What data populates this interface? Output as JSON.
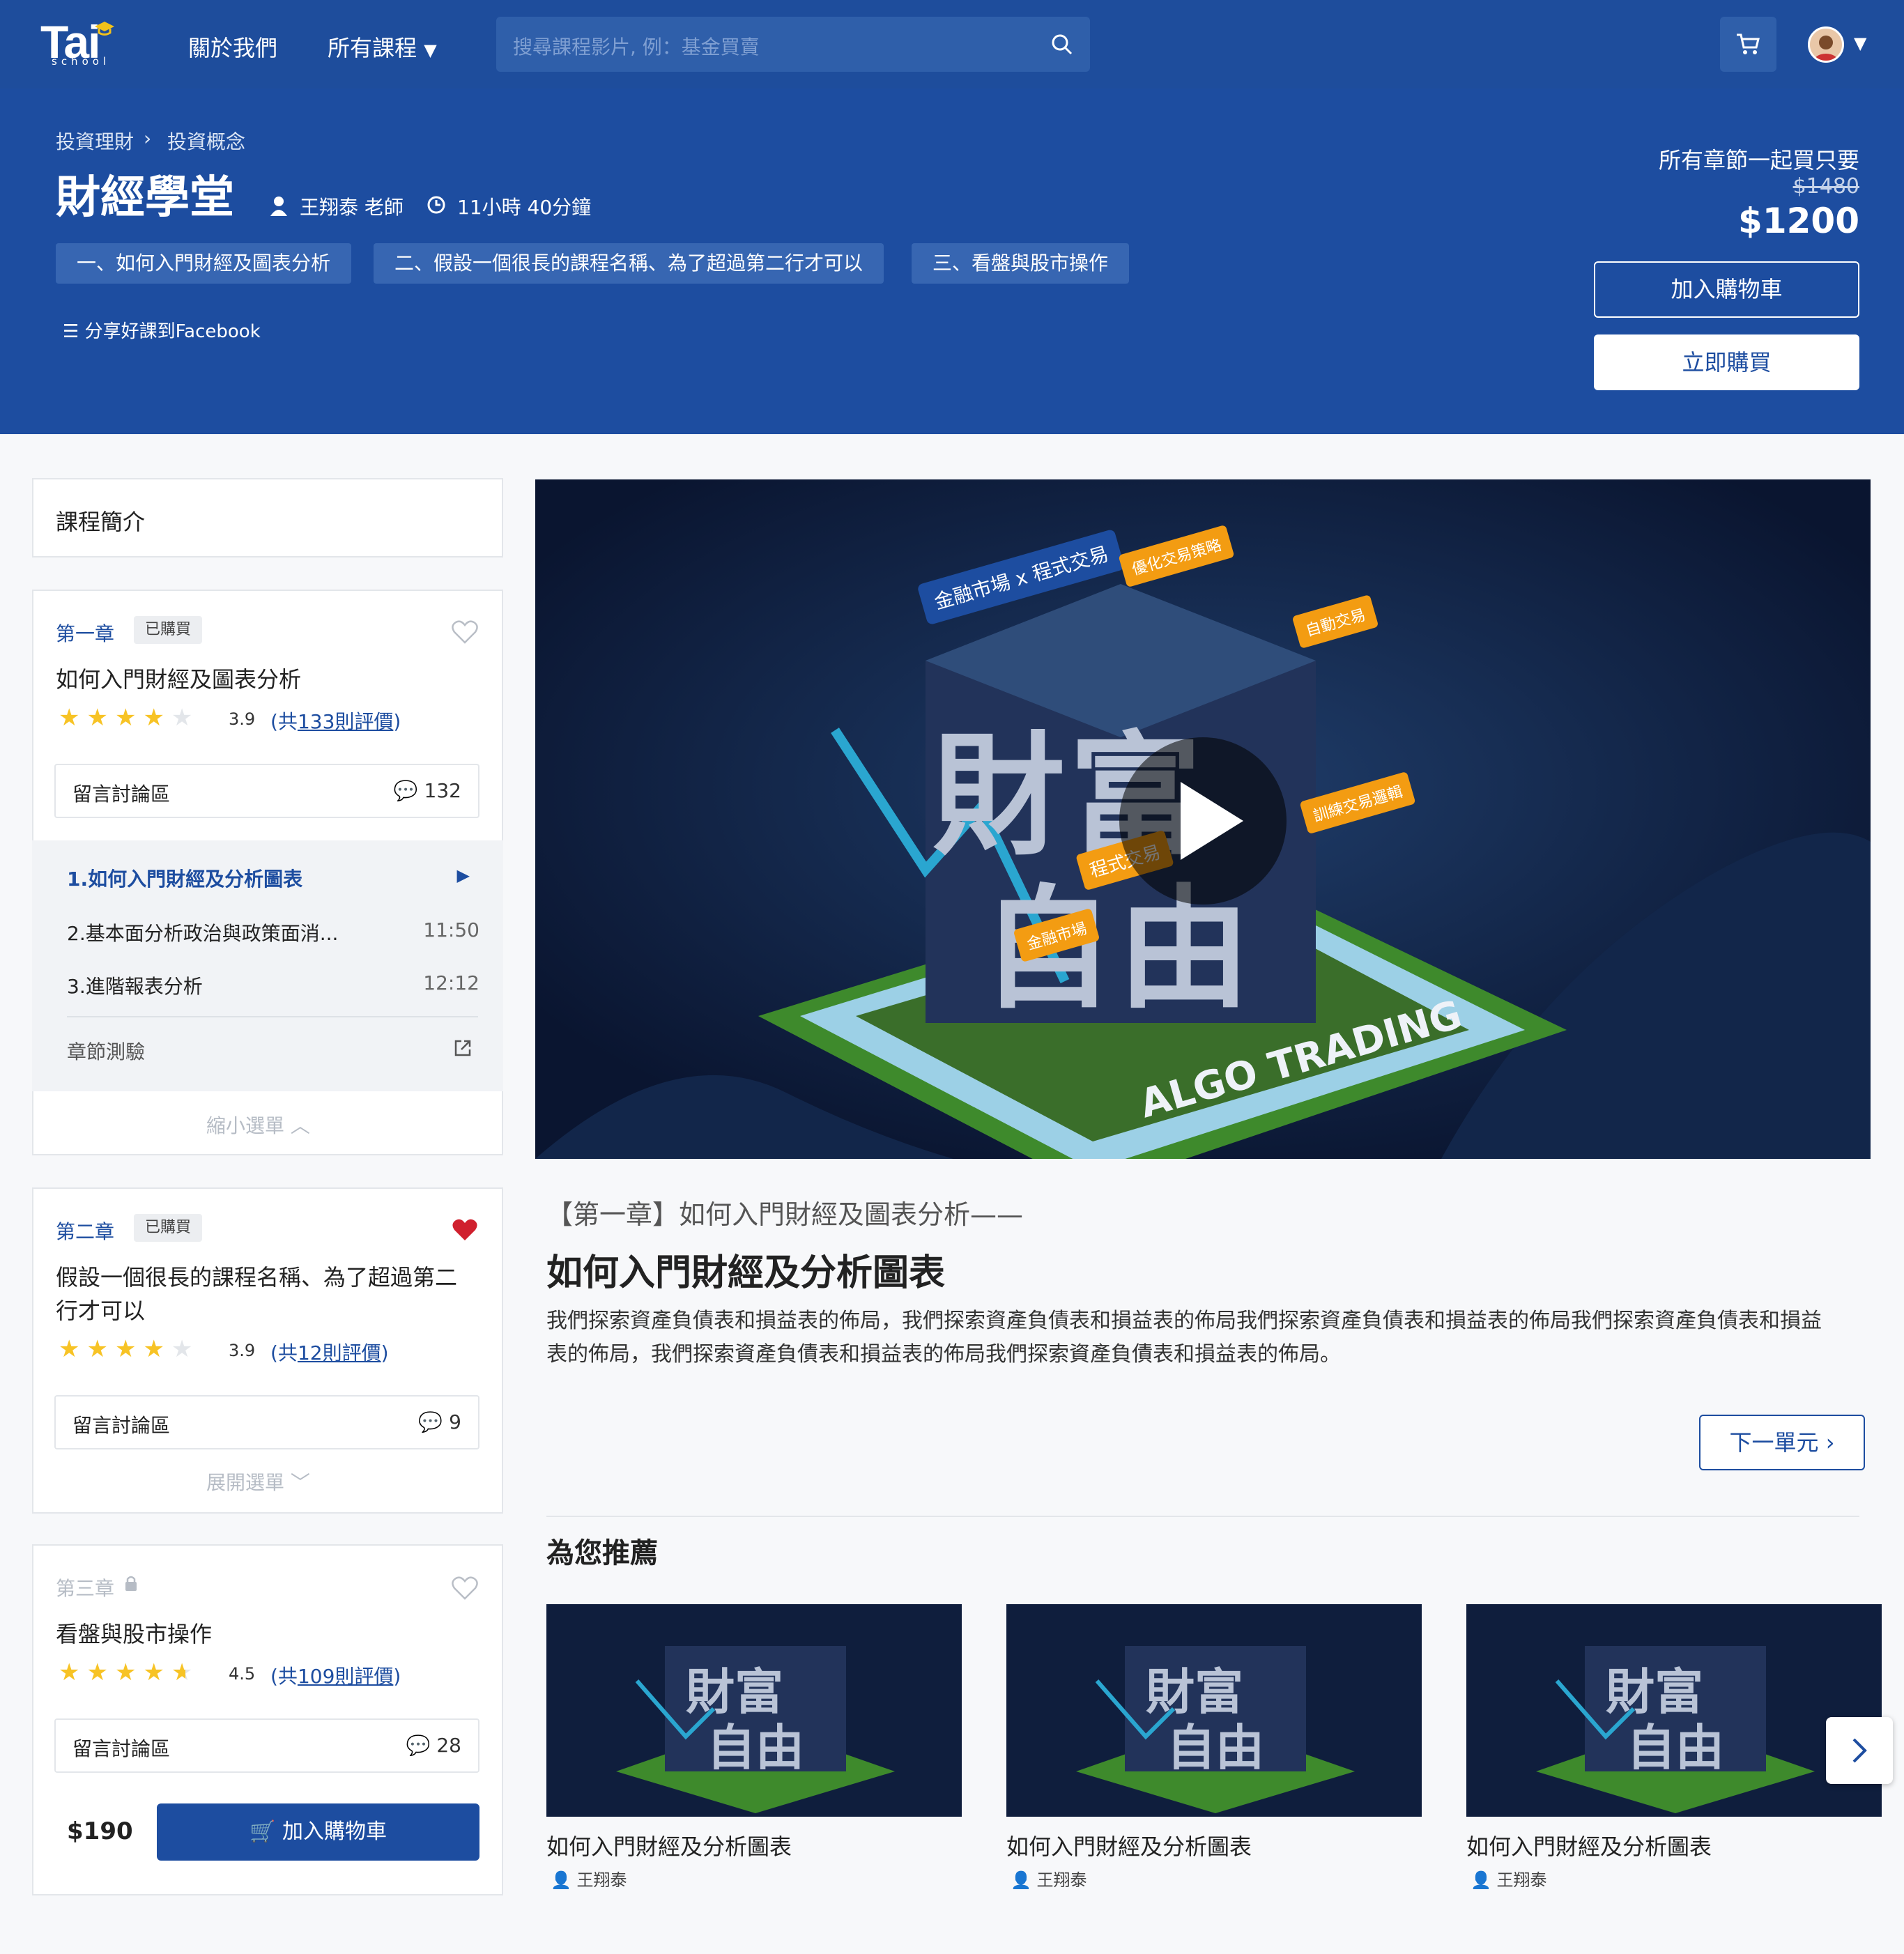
{
  "nav": {
    "logo": "Tai",
    "logo_sub": "school",
    "about": "關於我們",
    "courses": "所有課程",
    "search_placeholder": "搜尋課程影片, 例：基金買賣"
  },
  "hero": {
    "breadcrumb": [
      "投資理財",
      "投資概念"
    ],
    "title": "財經學堂",
    "teacher": "王翔泰 老師",
    "duration": "11小時 40分鐘",
    "tags": [
      "一、如何入門財經及圖表分析",
      "二、假設一個很長的課程名稱、為了超過第二行才可以",
      "三、看盤與股市操作"
    ],
    "share": "分享好課到Facebook",
    "price_note": "所有章節一起買只要",
    "price_old": "$1480",
    "price_new": "$1200",
    "add_cart": "加入購物車",
    "buy_now": "立即購買"
  },
  "sidebar": {
    "intro": "課程簡介",
    "chapters": [
      {
        "label": "第一章",
        "badge": "已購買",
        "title": "如何入門財經及圖表分析",
        "rating": "3.9",
        "reviews_prefix": "(共",
        "reviews_count": "133則評價",
        "reviews_suffix": ")",
        "discuss": "留言討論區",
        "comments": "132",
        "items": [
          {
            "name": "1.如何入門財經及分析圖表",
            "time": ""
          },
          {
            "name": "2.基本面分析政治與政策面消...",
            "time": "11:50"
          },
          {
            "name": "3.進階報表分析",
            "time": "12:12"
          }
        ],
        "quiz": "章節測驗",
        "toggle": "縮小選單"
      },
      {
        "label": "第二章",
        "badge": "已購買",
        "title_line1": "假設一個很長的課程名稱、為了超過第二",
        "title_line2": "行才可以",
        "rating": "3.9",
        "reviews_prefix": "(共",
        "reviews_count": "12則評價",
        "reviews_suffix": ")",
        "discuss": "留言討論區",
        "comments": "9",
        "toggle": "展開選單"
      },
      {
        "label": "第三章",
        "title": "看盤與股市操作",
        "rating": "4.5",
        "reviews_prefix": "(共",
        "reviews_count": "109則評價",
        "reviews_suffix": ")",
        "discuss": "留言討論區",
        "comments": "28",
        "price": "$190",
        "add_cart": "加入購物車"
      }
    ]
  },
  "video": {
    "bubble1": "金融市場 x 程式交易",
    "bubble2": "優化交易策略",
    "bubble3": "自動交易",
    "bubble4": "訓練交易邏輯",
    "bubble5": "程式交易",
    "bubble6": "金融市場",
    "big1": "財富",
    "big2": "自由",
    "banner": "ALGO TRADING"
  },
  "lesson": {
    "subtitle": "【第一章】如何入門財經及圖表分析——",
    "title": "如何入門財經及分析圖表",
    "desc": "我們探索資產負債表和損益表的佈局，我們探索資產負債表和損益表的佈局我們探索資產負債表和損益表的佈局我們探索資產負債表和損益表的佈局，我們探索資產負債表和損益表的佈局我們探索資產負債表和損益表的佈局。",
    "next": "下一單元"
  },
  "recommend": {
    "heading": "為您推薦",
    "items": [
      {
        "title": "如何入門財經及分析圖表",
        "author": "王翔泰"
      },
      {
        "title": "如何入門財經及分析圖表",
        "author": "王翔泰"
      },
      {
        "title": "如何入門財經及分析圖表",
        "author": "王翔泰"
      }
    ]
  },
  "colors": {
    "primary": "#1d4da0",
    "star": "#f7c325",
    "heart": "#d0202e"
  }
}
